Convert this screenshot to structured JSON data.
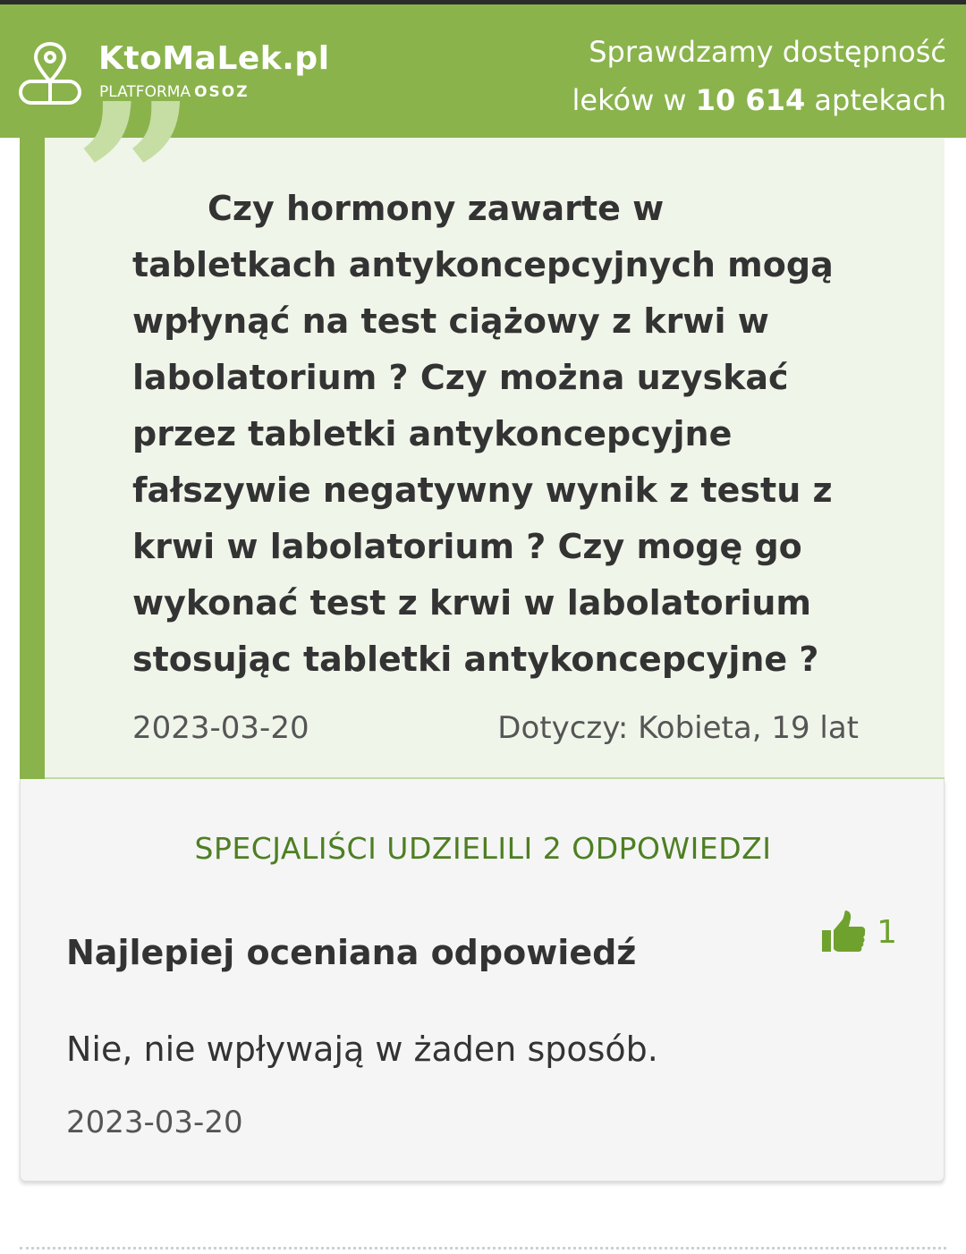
{
  "header": {
    "logo_title": "KtoMaLek.pl",
    "logo_sub": "PLATFORMA",
    "logo_brand": "OSOZ",
    "tagline_line1": "Sprawdzamy dostępność",
    "tagline_line2_pre": "leków w ",
    "tagline_count": "10 614",
    "tagline_line2_post": " aptekach"
  },
  "question": {
    "text": "Czy hormony zawarte w tabletkach antykoncepcyjnych mogą wpłynąć na test ciążowy z krwi w labolatorium ? Czy można uzyskać przez tabletki antykoncepcyjne fałszywie negatywny wynik z testu z krwi w labolatorium ? Czy mogę go wykonać test z krwi w labolatorium stosując tabletki antykoncepcyjne ?",
    "date": "2023-03-20",
    "about": "Dotyczy: Kobieta, 19 lat"
  },
  "answers": {
    "count_label": "SPECJALIŚCI UDZIELILI 2 ODPOWIEDZI",
    "best_title": "Najlepiej oceniana odpowiedź",
    "likes": "1",
    "best_text": "Nie, nie wpływają w żaden sposób.",
    "best_date": "2023-03-20"
  },
  "colors": {
    "brand_green": "#8ab34c",
    "light_green": "#f0f5ea",
    "heading_green": "#4e7f23"
  },
  "icons": {
    "logo": "location-pin-pill-icon",
    "like": "thumbs-up-icon",
    "quote": "quote-mark-icon"
  }
}
